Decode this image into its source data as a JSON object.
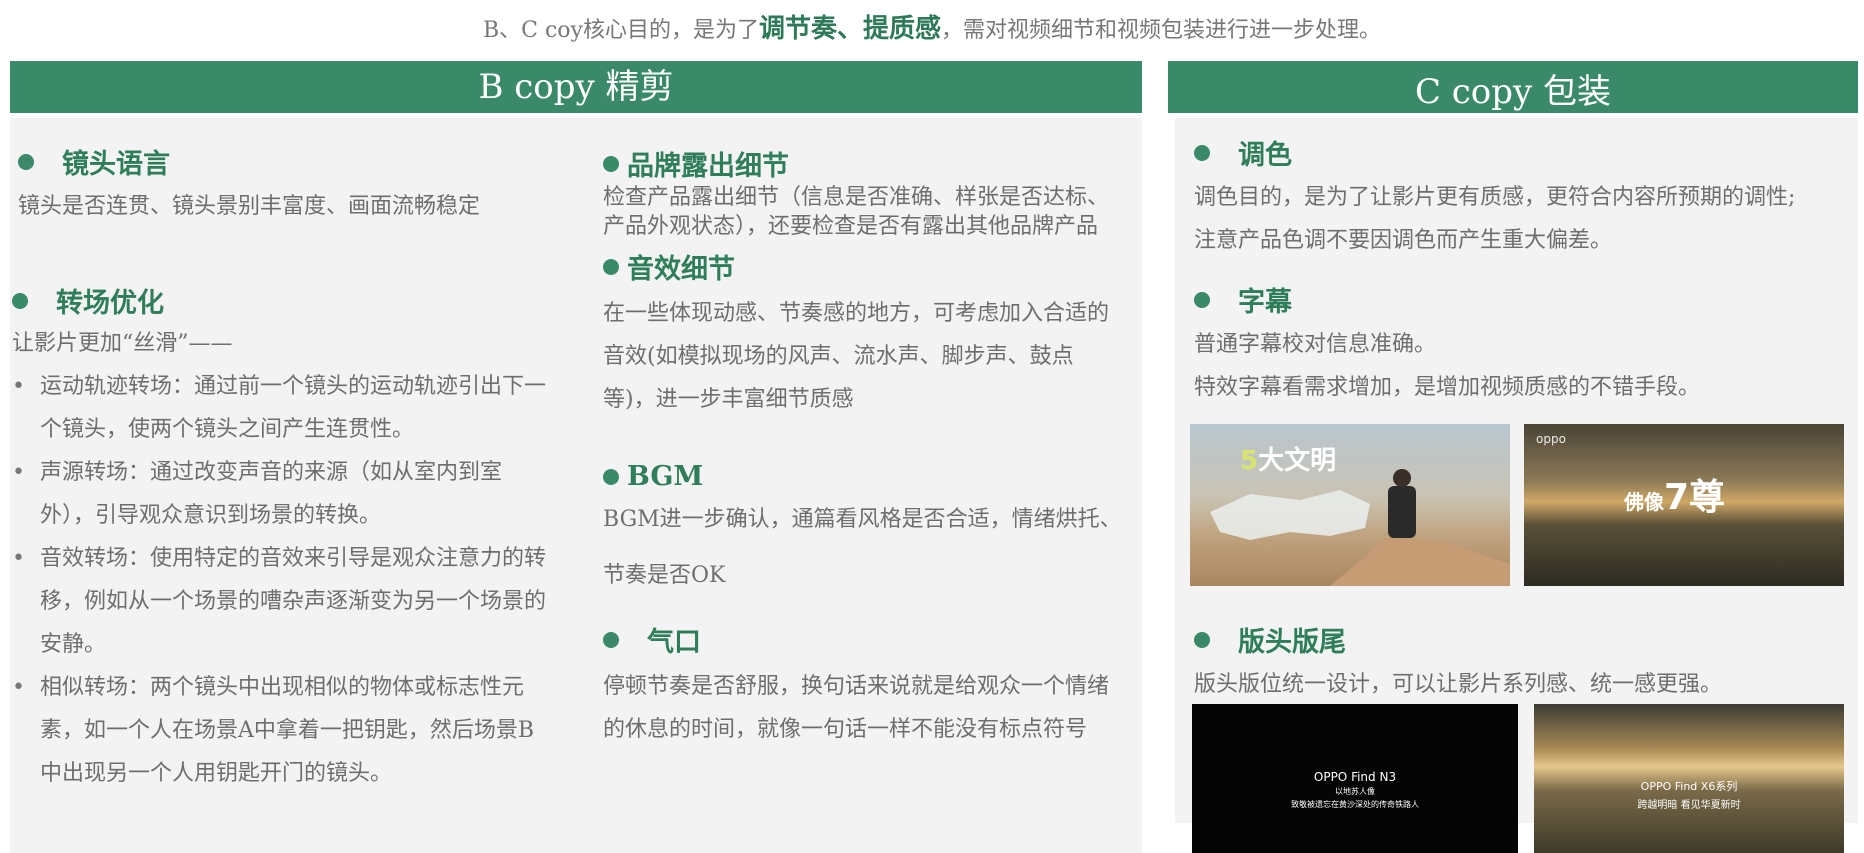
{
  "intro": {
    "pre": "B、C coy核心目的，是为了",
    "highlight": "调节奏、提质感",
    "post": "，需对视频细节和视频包装进行进一步处理。"
  },
  "b_section": {
    "title": "B copy 精剪",
    "left": {
      "h1": "镜头语言",
      "p1": "镜头是否连贯、镜头景别丰富度、画面流畅稳定",
      "h2": "转场优化",
      "p2": "让影片更加“丝滑”——",
      "bullets": [
        "运动轨迹转场：通过前一个镜头的运动轨迹引出下一个镜头，使两个镜头之间产生连贯性。",
        "声源转场：通过改变声音的来源（如从室内到室外），引导观众意识到场景的转换。",
        "音效转场：使用特定的音效来引导是观众注意力的转移，例如从一个场景的嘈杂声逐渐变为另一个场景的安静。",
        "相似转场：两个镜头中出现相似的物体或标志性元素，如一个人在场景A中拿着一把钥匙，然后场景B中出现另一个人用钥匙开门的镜头。"
      ]
    },
    "right": {
      "h1": "品牌露出细节",
      "p1": "检查产品露出细节（信息是否准确、样张是否达标、",
      "p1b": "产品外观状态），还要检查是否有露出其他品牌产品",
      "h2": "音效细节",
      "p2": "在一些体现动感、节奏感的地方，可考虑加入合适的音效(如模拟现场的风声、流水声、脚步声、鼓点等)，进一步丰富细节质感",
      "h3": "BGM",
      "p3a": "BGM进一步确认，通篇看风格是否合适，情绪烘托、",
      "p3b": "节奏是否OK",
      "h4": "气口",
      "p4": "停顿节奏是否舒服，换句话来说就是给观众一个情绪的休息的时间，就像一句话一样不能没有标点符号"
    }
  },
  "c_section": {
    "title": "C copy 包装",
    "h1": "调色",
    "p1a": "调色目的，是为了让影片更有质感，更符合内容所预期的调性;",
    "p1b": "注意产品色调不要因调色而产生重大偏差。",
    "h2": "字幕",
    "p2a": "普通字幕校对信息准确。",
    "p2b": "特效字幕看需求增加，是增加视频质感的不错手段。",
    "img1_num": "5",
    "img1_text": "大文明",
    "img2_text": "佛像",
    "img2_num": "7尊",
    "img2_brand": "oppo",
    "h3": "版头版尾",
    "p3": "版头版位统一设计，可以让影片系列感、统一感更强。",
    "img3_title": "OPPO Find N3",
    "img3_sub1": "以地苏人像",
    "img3_sub2": "致敬被遗忘在黄沙深处的传奇铁路人",
    "img4_title": "OPPO Find X6系列",
    "img4_sub": "跨越明暗  看见华夏新时"
  },
  "colors": {
    "accent": "#3a8a6a",
    "heading": "#2f7e5a",
    "panel": "#f3f3f3"
  }
}
